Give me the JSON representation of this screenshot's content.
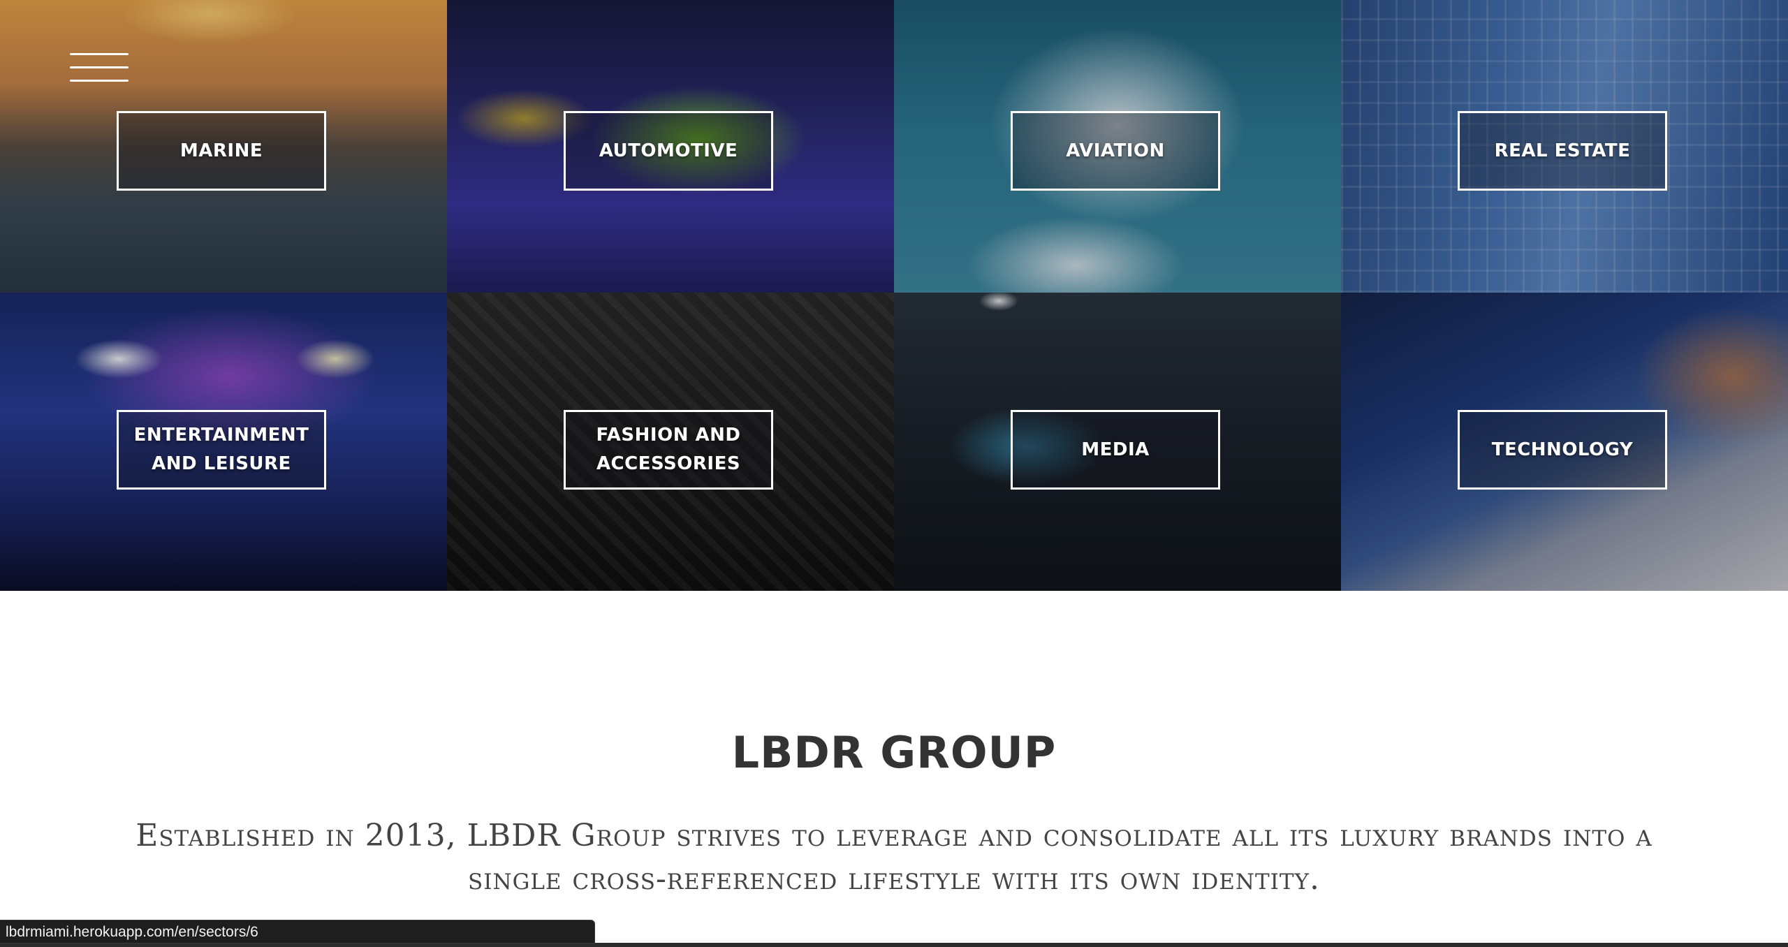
{
  "header": {
    "menu_icon": "hamburger-menu-icon"
  },
  "sectors": [
    {
      "label": "MARINE"
    },
    {
      "label": "AUTOMOTIVE"
    },
    {
      "label": "AVIATION"
    },
    {
      "label": "REAL ESTATE"
    },
    {
      "label": "ENTERTAINMENT AND LEISURE"
    },
    {
      "label": "FASHION AND ACCESSORIES"
    },
    {
      "label": "MEDIA"
    },
    {
      "label": "TECHNOLOGY"
    }
  ],
  "intro": {
    "title": "LBDR GROUP",
    "text": "Established in 2013, LBDR Group strives to leverage and consolidate all its luxury brands into a single cross-referenced lifestyle with its own identity."
  },
  "status_bar": {
    "url": "lbdrmiami.herokuapp.com/en/sectors/6"
  }
}
